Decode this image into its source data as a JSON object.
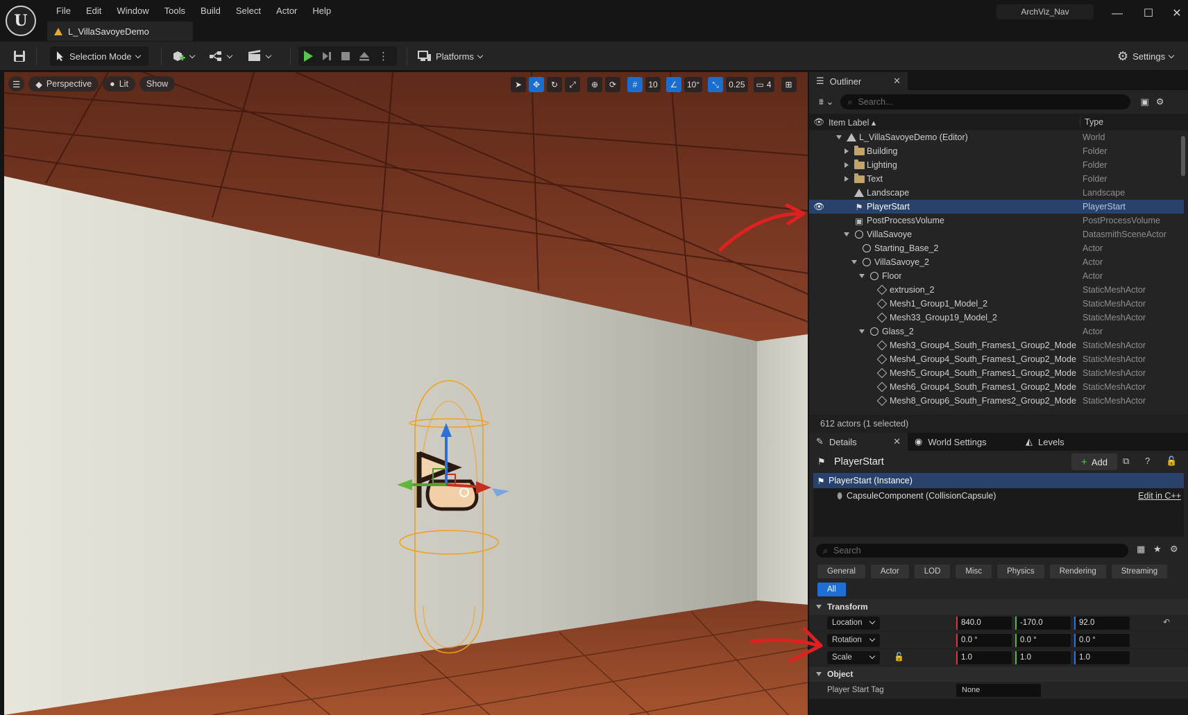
{
  "app": {
    "menu": [
      "File",
      "Edit",
      "Window",
      "Tools",
      "Build",
      "Select",
      "Actor",
      "Help"
    ],
    "level_tab": "L_VillaSavoyeDemo",
    "project_name": "ArchViz_Nav",
    "logo_letter": "U"
  },
  "toolbar": {
    "selection_mode": "Selection Mode",
    "platforms": "Platforms",
    "settings": "Settings"
  },
  "viewport": {
    "perspective": "Perspective",
    "lit": "Lit",
    "show": "Show",
    "grid_snap": "10",
    "rotation_snap": "10°",
    "scale_snap": "0.25",
    "camera_speed": "4"
  },
  "outliner": {
    "tab": "Outliner",
    "search_placeholder": "Search...",
    "col_label": "Item Label ▴",
    "col_type": "Type",
    "status": "612 actors (1 selected)",
    "rows": [
      {
        "name": "L_VillaSavoyeDemo (Editor)",
        "type": "World",
        "indent": 0,
        "expander": "down",
        "icon": "world-icon"
      },
      {
        "name": "Building",
        "type": "Folder",
        "indent": 1,
        "expander": "right",
        "icon": "folder-icon"
      },
      {
        "name": "Lighting",
        "type": "Folder",
        "indent": 1,
        "expander": "right",
        "icon": "folder-icon"
      },
      {
        "name": "Text",
        "type": "Folder",
        "indent": 1,
        "expander": "right",
        "icon": "folder-icon"
      },
      {
        "name": "Landscape",
        "type": "Landscape",
        "indent": 1,
        "expander": "",
        "icon": "landscape-icon"
      },
      {
        "name": "PlayerStart",
        "type": "PlayerStart",
        "indent": 1,
        "expander": "",
        "icon": "player-start-icon",
        "selected": true
      },
      {
        "name": "PostProcessVolume",
        "type": "PostProcessVolume",
        "indent": 1,
        "expander": "",
        "icon": "volume-icon"
      },
      {
        "name": "VillaSavoye",
        "type": "DatasmithSceneActor",
        "indent": 1,
        "expander": "down",
        "icon": "actor-icon"
      },
      {
        "name": "Starting_Base_2",
        "type": "Actor",
        "indent": 2,
        "expander": "",
        "icon": "actor-icon"
      },
      {
        "name": "VillaSavoye_2",
        "type": "Actor",
        "indent": 2,
        "expander": "down",
        "icon": "actor-icon"
      },
      {
        "name": "Floor",
        "type": "Actor",
        "indent": 3,
        "expander": "down",
        "icon": "actor-icon"
      },
      {
        "name": "extrusion_2",
        "type": "StaticMeshActor",
        "indent": 4,
        "expander": "",
        "icon": "static-mesh-icon"
      },
      {
        "name": "Mesh1_Group1_Model_2",
        "type": "StaticMeshActor",
        "indent": 4,
        "expander": "",
        "icon": "static-mesh-icon"
      },
      {
        "name": "Mesh33_Group19_Model_2",
        "type": "StaticMeshActor",
        "indent": 4,
        "expander": "",
        "icon": "static-mesh-icon"
      },
      {
        "name": "Glass_2",
        "type": "Actor",
        "indent": 3,
        "expander": "down",
        "icon": "actor-icon"
      },
      {
        "name": "Mesh3_Group4_South_Frames1_Group2_Mode",
        "type": "StaticMeshActor",
        "indent": 4,
        "expander": "",
        "icon": "static-mesh-icon"
      },
      {
        "name": "Mesh4_Group4_South_Frames1_Group2_Mode",
        "type": "StaticMeshActor",
        "indent": 4,
        "expander": "",
        "icon": "static-mesh-icon"
      },
      {
        "name": "Mesh5_Group4_South_Frames1_Group2_Mode",
        "type": "StaticMeshActor",
        "indent": 4,
        "expander": "",
        "icon": "static-mesh-icon"
      },
      {
        "name": "Mesh6_Group4_South_Frames1_Group2_Mode",
        "type": "StaticMeshActor",
        "indent": 4,
        "expander": "",
        "icon": "static-mesh-icon"
      },
      {
        "name": "Mesh8_Group6_South_Frames2_Group2_Mode",
        "type": "StaticMeshActor",
        "indent": 4,
        "expander": "",
        "icon": "static-mesh-icon"
      }
    ]
  },
  "details": {
    "tabs": [
      "Details",
      "World Settings",
      "Levels"
    ],
    "title": "PlayerStart",
    "add_label": "Add",
    "components": [
      {
        "name": "PlayerStart (Instance)",
        "selected": true
      },
      {
        "name": "CapsuleComponent (CollisionCapsule)",
        "selected": false
      }
    ],
    "edit_in_cpp": "Edit in C++",
    "search_placeholder": "Search",
    "filter_tabs": [
      "General",
      "Actor",
      "LOD",
      "Misc",
      "Physics",
      "Rendering",
      "Streaming",
      "All"
    ],
    "active_filter": "All",
    "transform_category": "Transform",
    "location_label": "Location",
    "location": [
      "840.0",
      "-170.0",
      "92.0"
    ],
    "rotation_label": "Rotation",
    "rotation": [
      "0.0 °",
      "0.0 °",
      "0.0 °"
    ],
    "scale_label": "Scale",
    "scale": [
      "1.0",
      "1.0",
      "1.0"
    ],
    "object_category": "Object",
    "player_start_tag_label": "Player Start Tag",
    "player_start_tag_value": "None"
  }
}
